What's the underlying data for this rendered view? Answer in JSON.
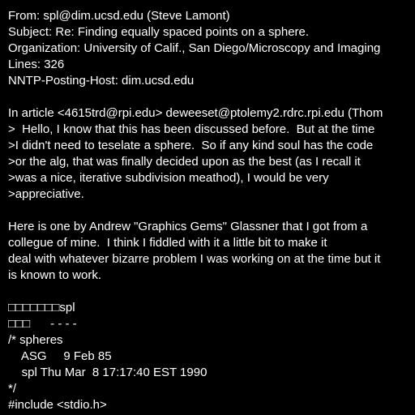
{
  "lines": [
    "From: spl@dim.ucsd.edu (Steve Lamont)",
    "Subject: Re: Finding equally spaced points on a sphere.",
    "Organization: University of Calif., San Diego/Microscopy and Imaging",
    "Lines: 326",
    "NNTP-Posting-Host: dim.ucsd.edu",
    "",
    "In article <4615trd@rpi.edu> deweeset@ptolemy2.rdrc.rpi.edu (Thom",
    ">  Hello, I know that this has been discussed before.  But at the time",
    ">I didn't need to teselate a sphere.  So if any kind soul has the code",
    ">or the alg, that was finally decided upon as the best (as I recall it",
    ">was a nice, iterative subdivision meathod), I would be very",
    ">appreciative.",
    "",
    "Here is one by Andrew \"Graphics Gems\" Glassner that I got from a",
    "collegue of mine.  I think I fiddled with it a little bit to make it",
    "deal with whatever bizarre problem I was working on at the time but it",
    "is known to work.",
    "",
    "□□□□□□□spl",
    "□□□      - - - -",
    "/* spheres",
    "    ASG     9 Feb 85",
    "    spl Thu Mar  8 17:17:40 EST 1990",
    "*/",
    "#include <stdio.h>"
  ]
}
